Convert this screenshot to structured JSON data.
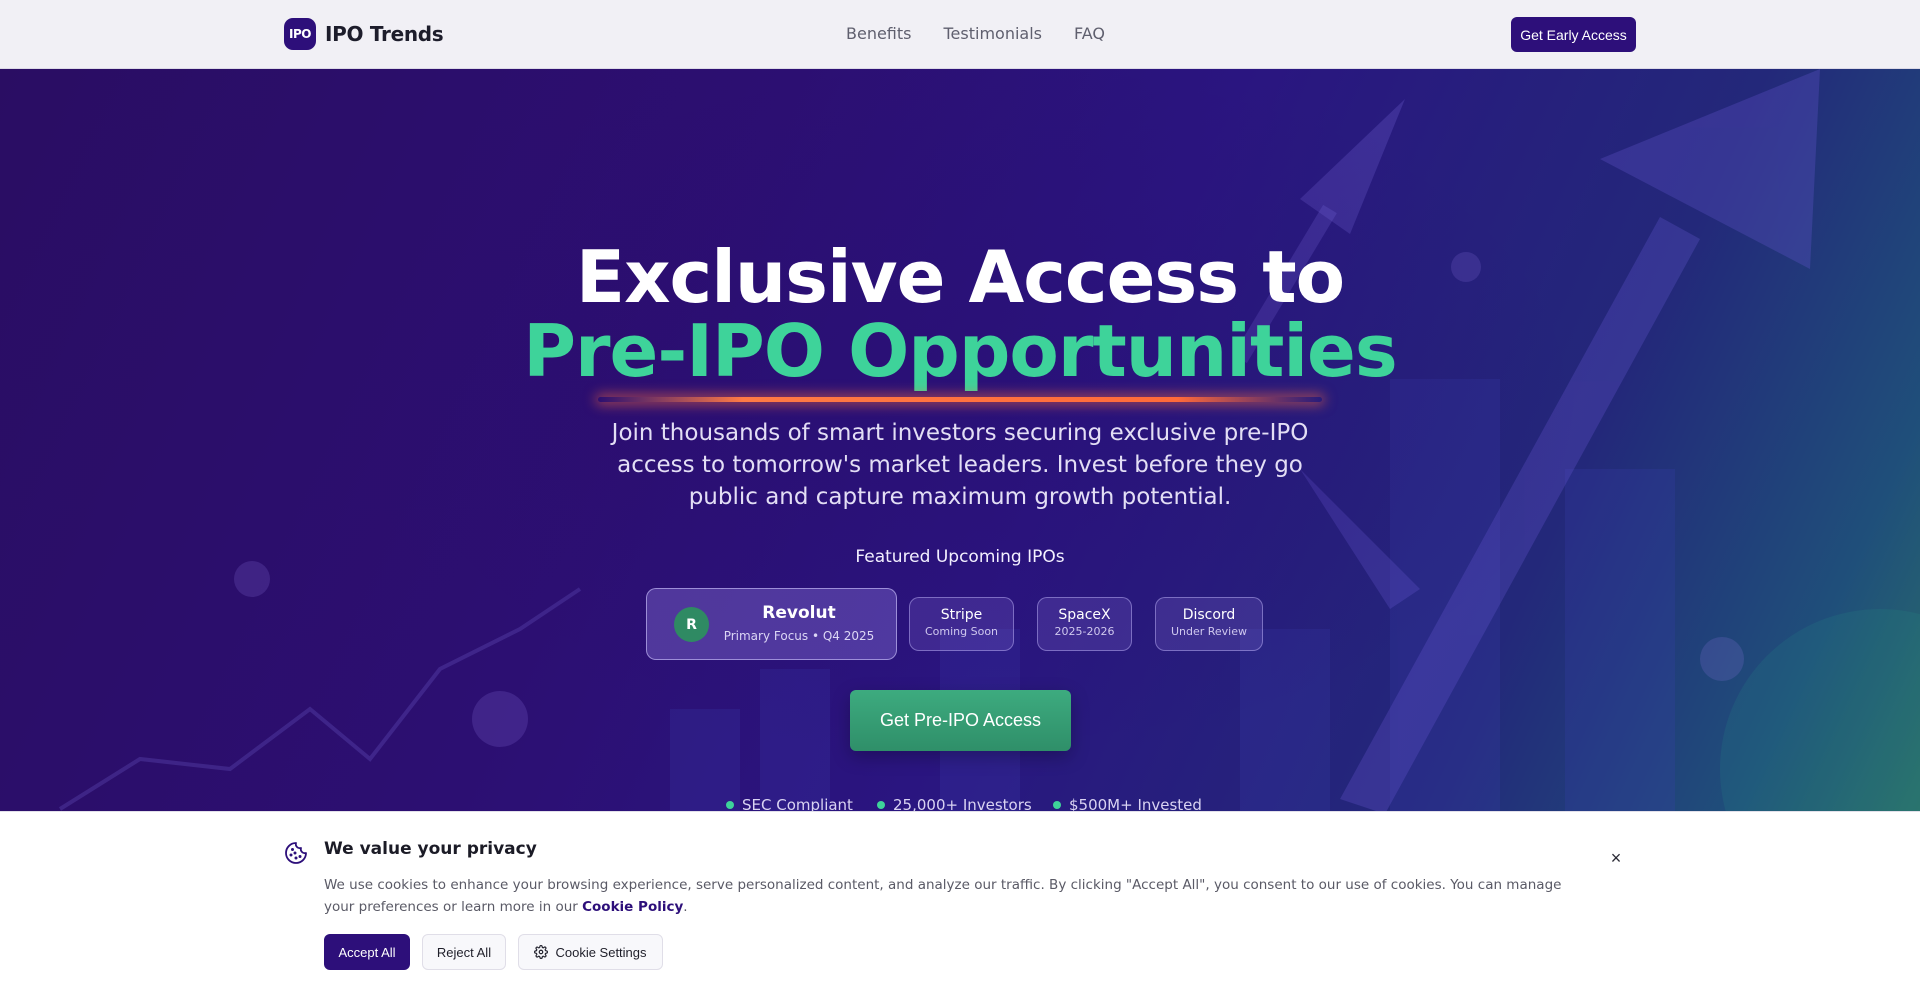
{
  "nav": {
    "logo_text": "IPO",
    "brand": "IPO Trends",
    "links": [
      "Benefits",
      "Testimonials",
      "FAQ"
    ],
    "cta": "Get Early Access"
  },
  "hero": {
    "headline_line1": "Exclusive Access to",
    "headline_line2": "Pre-IPO Opportunities",
    "subhead": "Join thousands of smart investors securing exclusive pre-IPO access to tomorrow's market leaders. Invest before they go public and capture maximum growth potential.",
    "featured_label": "Featured Upcoming IPOs",
    "primary_ipo": {
      "initial": "R",
      "name": "Revolut",
      "subtitle": "Primary Focus • Q4 2025"
    },
    "other_ipos": [
      {
        "name": "Stripe",
        "status": "Coming Soon"
      },
      {
        "name": "SpaceX",
        "status": "2025-2026"
      },
      {
        "name": "Discord",
        "status": "Under Review"
      }
    ],
    "cta": "Get Pre-IPO Access",
    "trust": [
      "SEC Compliant",
      "25,000+ Investors",
      "$500M+ Invested"
    ]
  },
  "cookie": {
    "title": "We value your privacy",
    "text": "We use cookies to enhance your browsing experience, serve personalized content, and analyze our traffic. By clicking \"Accept All\", you consent to our use of cookies. You can manage your preferences or learn more in our",
    "link": "Cookie Policy",
    "link_suffix": ".",
    "accept": "Accept All",
    "reject": "Reject All",
    "settings": "Cookie Settings",
    "close": "×"
  },
  "colors": {
    "brand": "#2d0f7a",
    "accent_green": "#3ed39a",
    "cta_green": "#3dab7f",
    "underline_orange": "#ff7a45"
  },
  "icons": {
    "cookie": "cookie-icon",
    "settings": "gear-icon",
    "close": "close-icon"
  }
}
